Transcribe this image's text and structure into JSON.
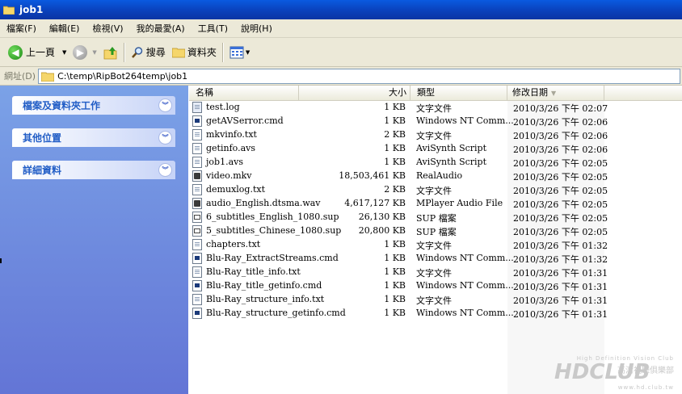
{
  "window": {
    "title": "job1"
  },
  "menu": [
    "檔案(F)",
    "編輯(E)",
    "檢視(V)",
    "我的最愛(A)",
    "工具(T)",
    "說明(H)"
  ],
  "toolbar": {
    "back": "上一頁",
    "search": "搜尋",
    "folders": "資料夾"
  },
  "address": {
    "label": "網址(D)",
    "path": "C:\\temp\\RipBot264temp\\job1"
  },
  "sidebar": {
    "panels": [
      "檔案及資料夾工作",
      "其他位置",
      "詳細資料"
    ]
  },
  "columns": {
    "name": "名稱",
    "size": "大小",
    "type": "類型",
    "modified": "修改日期"
  },
  "files": [
    {
      "name": "test.log",
      "size": "1 KB",
      "type": "文字文件",
      "modified": "2010/3/26 下午 02:07",
      "icon": "log-file-icon"
    },
    {
      "name": "getAVSerror.cmd",
      "size": "1 KB",
      "type": "Windows NT Comm...",
      "modified": "2010/3/26 下午 02:06",
      "icon": "cmd-file-icon"
    },
    {
      "name": "mkvinfo.txt",
      "size": "2 KB",
      "type": "文字文件",
      "modified": "2010/3/26 下午 02:06",
      "icon": "text-file-icon"
    },
    {
      "name": "getinfo.avs",
      "size": "1 KB",
      "type": "AviSynth Script",
      "modified": "2010/3/26 下午 02:06",
      "icon": "avs-file-icon"
    },
    {
      "name": "job1.avs",
      "size": "1 KB",
      "type": "AviSynth Script",
      "modified": "2010/3/26 下午 02:05",
      "icon": "avs-file-icon"
    },
    {
      "name": "video.mkv",
      "size": "18,503,461 KB",
      "type": "RealAudio",
      "modified": "2010/3/26 下午 02:05",
      "icon": "media-file-icon"
    },
    {
      "name": "demuxlog.txt",
      "size": "2 KB",
      "type": "文字文件",
      "modified": "2010/3/26 下午 02:05",
      "icon": "text-file-icon"
    },
    {
      "name": "audio_English.dtsma.wav",
      "size": "4,617,127 KB",
      "type": "MPlayer Audio File",
      "modified": "2010/3/26 下午 02:05",
      "icon": "audio-file-icon"
    },
    {
      "name": "6_subtitles_English_1080.sup",
      "size": "26,130 KB",
      "type": "SUP 檔案",
      "modified": "2010/3/26 下午 02:05",
      "icon": "sup-file-icon"
    },
    {
      "name": "5_subtitles_Chinese_1080.sup",
      "size": "20,800 KB",
      "type": "SUP 檔案",
      "modified": "2010/3/26 下午 02:05",
      "icon": "sup-file-icon"
    },
    {
      "name": "chapters.txt",
      "size": "1 KB",
      "type": "文字文件",
      "modified": "2010/3/26 下午 01:32",
      "icon": "text-file-icon"
    },
    {
      "name": "Blu-Ray_ExtractStreams.cmd",
      "size": "1 KB",
      "type": "Windows NT Comm...",
      "modified": "2010/3/26 下午 01:32",
      "icon": "cmd-file-icon"
    },
    {
      "name": "Blu-Ray_title_info.txt",
      "size": "1 KB",
      "type": "文字文件",
      "modified": "2010/3/26 下午 01:31",
      "icon": "text-file-icon"
    },
    {
      "name": "Blu-Ray_title_getinfo.cmd",
      "size": "1 KB",
      "type": "Windows NT Comm...",
      "modified": "2010/3/26 下午 01:31",
      "icon": "cmd-file-icon"
    },
    {
      "name": "Blu-Ray_structure_info.txt",
      "size": "1 KB",
      "type": "文字文件",
      "modified": "2010/3/26 下午 01:31",
      "icon": "text-file-icon"
    },
    {
      "name": "Blu-Ray_structure_getinfo.cmd",
      "size": "1 KB",
      "type": "Windows NT Comm...",
      "modified": "2010/3/26 下午 01:31",
      "icon": "cmd-file-icon"
    }
  ],
  "watermark": {
    "tagline": "High Definition Vision Club",
    "logo": "HDCLUB",
    "chinese": "高清視聽俱樂部",
    "url": "www.hd.club.tw"
  },
  "colors": {
    "titlebar": "#0a46cc",
    "sidebar": "#7ba2e7",
    "panel_text": "#215dc6"
  }
}
